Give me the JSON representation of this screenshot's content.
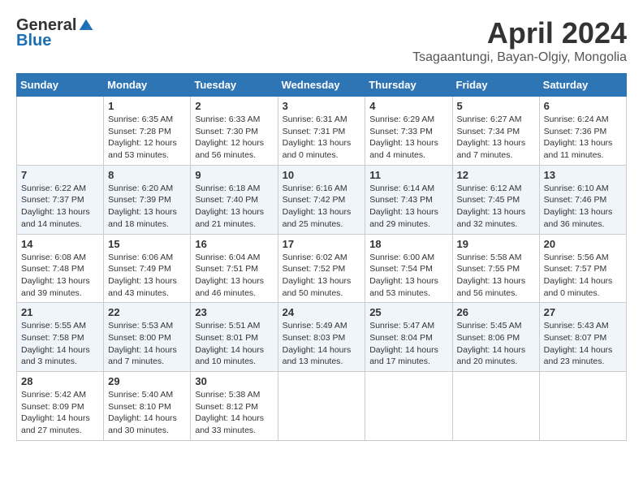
{
  "logo": {
    "general": "General",
    "blue": "Blue"
  },
  "title": "April 2024",
  "subtitle": "Tsagaantungi, Bayan-Olgiy, Mongolia",
  "headers": [
    "Sunday",
    "Monday",
    "Tuesday",
    "Wednesday",
    "Thursday",
    "Friday",
    "Saturday"
  ],
  "weeks": [
    [
      {
        "day": "",
        "info": ""
      },
      {
        "day": "1",
        "info": "Sunrise: 6:35 AM\nSunset: 7:28 PM\nDaylight: 12 hours\nand 53 minutes."
      },
      {
        "day": "2",
        "info": "Sunrise: 6:33 AM\nSunset: 7:30 PM\nDaylight: 12 hours\nand 56 minutes."
      },
      {
        "day": "3",
        "info": "Sunrise: 6:31 AM\nSunset: 7:31 PM\nDaylight: 13 hours\nand 0 minutes."
      },
      {
        "day": "4",
        "info": "Sunrise: 6:29 AM\nSunset: 7:33 PM\nDaylight: 13 hours\nand 4 minutes."
      },
      {
        "day": "5",
        "info": "Sunrise: 6:27 AM\nSunset: 7:34 PM\nDaylight: 13 hours\nand 7 minutes."
      },
      {
        "day": "6",
        "info": "Sunrise: 6:24 AM\nSunset: 7:36 PM\nDaylight: 13 hours\nand 11 minutes."
      }
    ],
    [
      {
        "day": "7",
        "info": "Sunrise: 6:22 AM\nSunset: 7:37 PM\nDaylight: 13 hours\nand 14 minutes."
      },
      {
        "day": "8",
        "info": "Sunrise: 6:20 AM\nSunset: 7:39 PM\nDaylight: 13 hours\nand 18 minutes."
      },
      {
        "day": "9",
        "info": "Sunrise: 6:18 AM\nSunset: 7:40 PM\nDaylight: 13 hours\nand 21 minutes."
      },
      {
        "day": "10",
        "info": "Sunrise: 6:16 AM\nSunset: 7:42 PM\nDaylight: 13 hours\nand 25 minutes."
      },
      {
        "day": "11",
        "info": "Sunrise: 6:14 AM\nSunset: 7:43 PM\nDaylight: 13 hours\nand 29 minutes."
      },
      {
        "day": "12",
        "info": "Sunrise: 6:12 AM\nSunset: 7:45 PM\nDaylight: 13 hours\nand 32 minutes."
      },
      {
        "day": "13",
        "info": "Sunrise: 6:10 AM\nSunset: 7:46 PM\nDaylight: 13 hours\nand 36 minutes."
      }
    ],
    [
      {
        "day": "14",
        "info": "Sunrise: 6:08 AM\nSunset: 7:48 PM\nDaylight: 13 hours\nand 39 minutes."
      },
      {
        "day": "15",
        "info": "Sunrise: 6:06 AM\nSunset: 7:49 PM\nDaylight: 13 hours\nand 43 minutes."
      },
      {
        "day": "16",
        "info": "Sunrise: 6:04 AM\nSunset: 7:51 PM\nDaylight: 13 hours\nand 46 minutes."
      },
      {
        "day": "17",
        "info": "Sunrise: 6:02 AM\nSunset: 7:52 PM\nDaylight: 13 hours\nand 50 minutes."
      },
      {
        "day": "18",
        "info": "Sunrise: 6:00 AM\nSunset: 7:54 PM\nDaylight: 13 hours\nand 53 minutes."
      },
      {
        "day": "19",
        "info": "Sunrise: 5:58 AM\nSunset: 7:55 PM\nDaylight: 13 hours\nand 56 minutes."
      },
      {
        "day": "20",
        "info": "Sunrise: 5:56 AM\nSunset: 7:57 PM\nDaylight: 14 hours\nand 0 minutes."
      }
    ],
    [
      {
        "day": "21",
        "info": "Sunrise: 5:55 AM\nSunset: 7:58 PM\nDaylight: 14 hours\nand 3 minutes."
      },
      {
        "day": "22",
        "info": "Sunrise: 5:53 AM\nSunset: 8:00 PM\nDaylight: 14 hours\nand 7 minutes."
      },
      {
        "day": "23",
        "info": "Sunrise: 5:51 AM\nSunset: 8:01 PM\nDaylight: 14 hours\nand 10 minutes."
      },
      {
        "day": "24",
        "info": "Sunrise: 5:49 AM\nSunset: 8:03 PM\nDaylight: 14 hours\nand 13 minutes."
      },
      {
        "day": "25",
        "info": "Sunrise: 5:47 AM\nSunset: 8:04 PM\nDaylight: 14 hours\nand 17 minutes."
      },
      {
        "day": "26",
        "info": "Sunrise: 5:45 AM\nSunset: 8:06 PM\nDaylight: 14 hours\nand 20 minutes."
      },
      {
        "day": "27",
        "info": "Sunrise: 5:43 AM\nSunset: 8:07 PM\nDaylight: 14 hours\nand 23 minutes."
      }
    ],
    [
      {
        "day": "28",
        "info": "Sunrise: 5:42 AM\nSunset: 8:09 PM\nDaylight: 14 hours\nand 27 minutes."
      },
      {
        "day": "29",
        "info": "Sunrise: 5:40 AM\nSunset: 8:10 PM\nDaylight: 14 hours\nand 30 minutes."
      },
      {
        "day": "30",
        "info": "Sunrise: 5:38 AM\nSunset: 8:12 PM\nDaylight: 14 hours\nand 33 minutes."
      },
      {
        "day": "",
        "info": ""
      },
      {
        "day": "",
        "info": ""
      },
      {
        "day": "",
        "info": ""
      },
      {
        "day": "",
        "info": ""
      }
    ]
  ]
}
